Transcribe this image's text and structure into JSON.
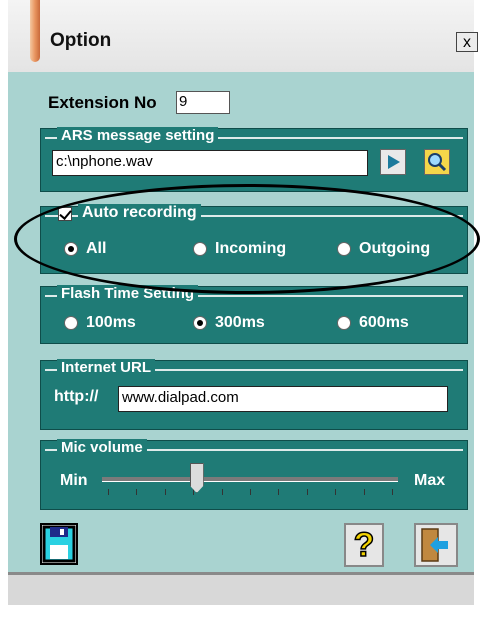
{
  "window": {
    "title": "Option",
    "close_label": "x"
  },
  "extension": {
    "label": "Extension No",
    "value": "9"
  },
  "ars": {
    "title": "ARS message setting",
    "file_value": "c:\\nphone.wav",
    "play_icon": "play-icon",
    "browse_icon": "magnifier-icon"
  },
  "auto_recording": {
    "title": "Auto recording",
    "checked": true,
    "options": [
      {
        "label": "All",
        "selected": true
      },
      {
        "label": "Incoming",
        "selected": false
      },
      {
        "label": "Outgoing",
        "selected": false
      }
    ]
  },
  "flash_time": {
    "title": "Flash Time Setting",
    "options": [
      {
        "label": "100ms",
        "selected": false
      },
      {
        "label": "300ms",
        "selected": true
      },
      {
        "label": "600ms",
        "selected": false
      }
    ]
  },
  "internet_url": {
    "title": "Internet URL",
    "prefix": "http://",
    "value": "www.dialpad.com"
  },
  "mic_volume": {
    "title": "Mic volume",
    "min_label": "Min",
    "max_label": "Max",
    "level_fraction": 0.32
  },
  "buttons": {
    "save_icon": "floppy-disk-icon",
    "help_icon": "question-mark-icon",
    "exit_icon": "door-exit-icon",
    "help_glyph": "?"
  },
  "colors": {
    "panel_bg": "#a9d3d0",
    "group_bg": "#1f7b76",
    "help_yellow": "#f2d200",
    "floppy_cyan": "#2ad1e2"
  }
}
